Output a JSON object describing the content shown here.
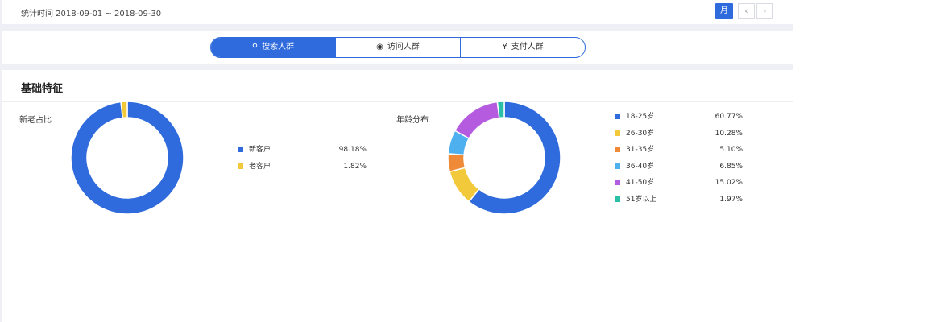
{
  "header": {
    "date_range": "统计时间 2018-09-01 ~ 2018-09-30",
    "period_button": "月",
    "prev_icon": "‹",
    "next_icon": "›"
  },
  "tabs": [
    {
      "label": "搜索人群",
      "icon": "search-icon",
      "glyph": "⚲",
      "active": true
    },
    {
      "label": "访问人群",
      "icon": "eye-icon",
      "glyph": "◉",
      "active": false
    },
    {
      "label": "支付人群",
      "icon": "yen-icon",
      "glyph": "¥",
      "active": false
    }
  ],
  "section": {
    "title": "基础特征"
  },
  "chart_data": [
    {
      "type": "pie",
      "style": "donut",
      "title": "新老占比",
      "categories": [
        "新客户",
        "老客户"
      ],
      "values": [
        98.18,
        1.82
      ],
      "labels": [
        "98.18%",
        "1.82%"
      ],
      "colors": [
        "#2f6bdc",
        "#f2c93a"
      ],
      "legend": "right"
    },
    {
      "type": "pie",
      "style": "donut",
      "title": "年龄分布",
      "categories": [
        "18-25岁",
        "26-30岁",
        "31-35岁",
        "36-40岁",
        "41-50岁",
        "51岁以上"
      ],
      "values": [
        60.77,
        10.28,
        5.1,
        6.85,
        15.02,
        1.97
      ],
      "labels": [
        "60.77%",
        "10.28%",
        "5.10%",
        "6.85%",
        "15.02%",
        "1.97%"
      ],
      "colors": [
        "#2f6bdc",
        "#f2c93a",
        "#ef8a38",
        "#4fb0ef",
        "#b55be0",
        "#2bbfa8"
      ],
      "legend": "right"
    }
  ]
}
